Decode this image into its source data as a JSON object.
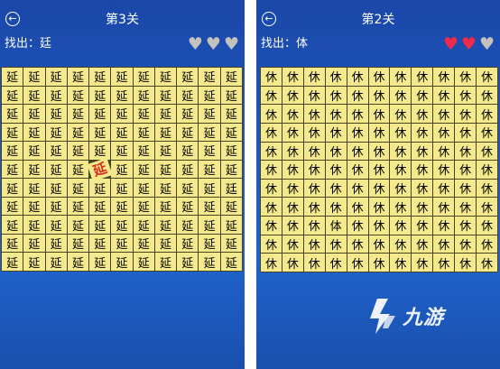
{
  "screens": [
    {
      "title": "第3关",
      "find_label": "找出：",
      "find_target": "廷",
      "hearts": [
        "off",
        "off",
        "off"
      ],
      "base_char": "延",
      "rows": 11,
      "cols": 11,
      "overrides": [
        {
          "row": 5,
          "col": 4,
          "char": "延",
          "state": "wrong"
        },
        {
          "row": 6,
          "col": 10,
          "char": "廷",
          "state": "normal"
        }
      ]
    },
    {
      "title": "第2关",
      "find_label": "找出：",
      "find_target": "体",
      "hearts": [
        "on",
        "on",
        "off"
      ],
      "base_char": "休",
      "rows": 11,
      "cols": 11,
      "overrides": [
        {
          "row": 8,
          "col": 3,
          "char": "体",
          "state": "normal"
        }
      ]
    }
  ],
  "brand": {
    "text": "九游"
  },
  "icons": {
    "back": "back-arrow-circle-icon",
    "heart": "heart-icon",
    "logo": "nine-game-logo-icon"
  },
  "colors": {
    "background": "#1d57bd",
    "tile": "#f5e98e",
    "tile_border": "#4a4320",
    "heart_on": "#ef2b4c",
    "heart_off": "#c4c2bd",
    "wrong_mark": "#d92b1a"
  }
}
